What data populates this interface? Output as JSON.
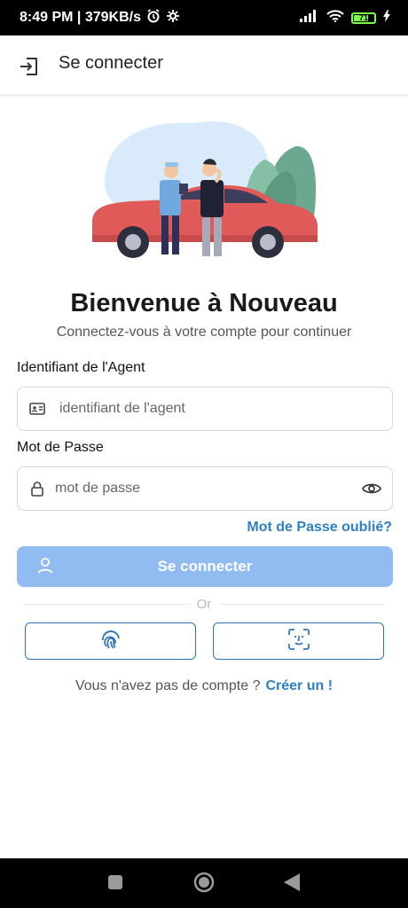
{
  "status_bar": {
    "time_speed": "8:49 PM | 379KB/s",
    "battery_level": "71"
  },
  "app_bar": {
    "title": "Se connecter",
    "icon": "login-icon"
  },
  "welcome": {
    "title": "Bienvenue à Nouveau",
    "subtitle": "Connectez-vous à votre compte pour continuer"
  },
  "form": {
    "agent_label": "Identifiant de l'Agent",
    "agent_placeholder": "identifiant de l'agent",
    "password_label": "Mot de Passe",
    "password_placeholder": "mot de passe",
    "forgot_label": "Mot de Passe oublié?",
    "submit_label": "Se connecter",
    "divider_text": "Or"
  },
  "signup": {
    "prompt": "Vous n'avez pas de compte ?",
    "link": "Créer un !"
  },
  "colors": {
    "accent": "#2f7fc3",
    "button_disabled": "#91bcf2",
    "car": "#e05a5a"
  }
}
